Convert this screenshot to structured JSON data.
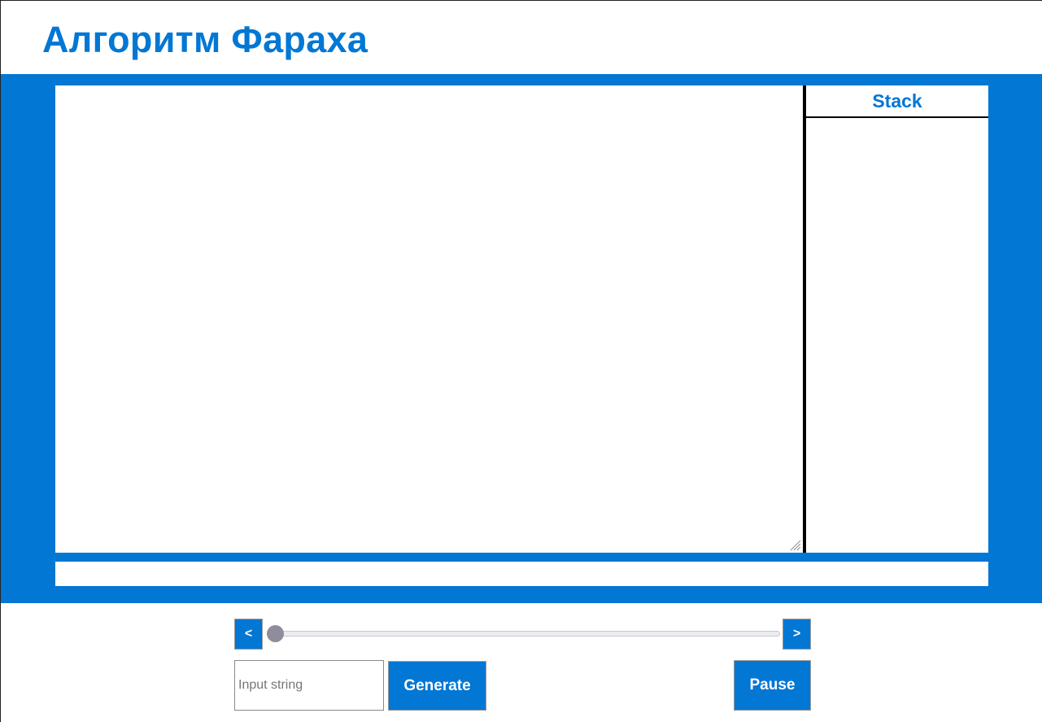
{
  "header": {
    "title": "Алгоритм Фараха"
  },
  "colors": {
    "accent": "#0277d4",
    "background": "#ffffff",
    "divider": "#000000",
    "slider_thumb": "#8f8d9b"
  },
  "stack_panel": {
    "title": "Stack"
  },
  "controls": {
    "prev_label": "<",
    "next_label": ">",
    "slider_value": 0,
    "input_placeholder": "Input string",
    "input_value": "",
    "generate_label": "Generate",
    "pause_label": "Pause"
  }
}
